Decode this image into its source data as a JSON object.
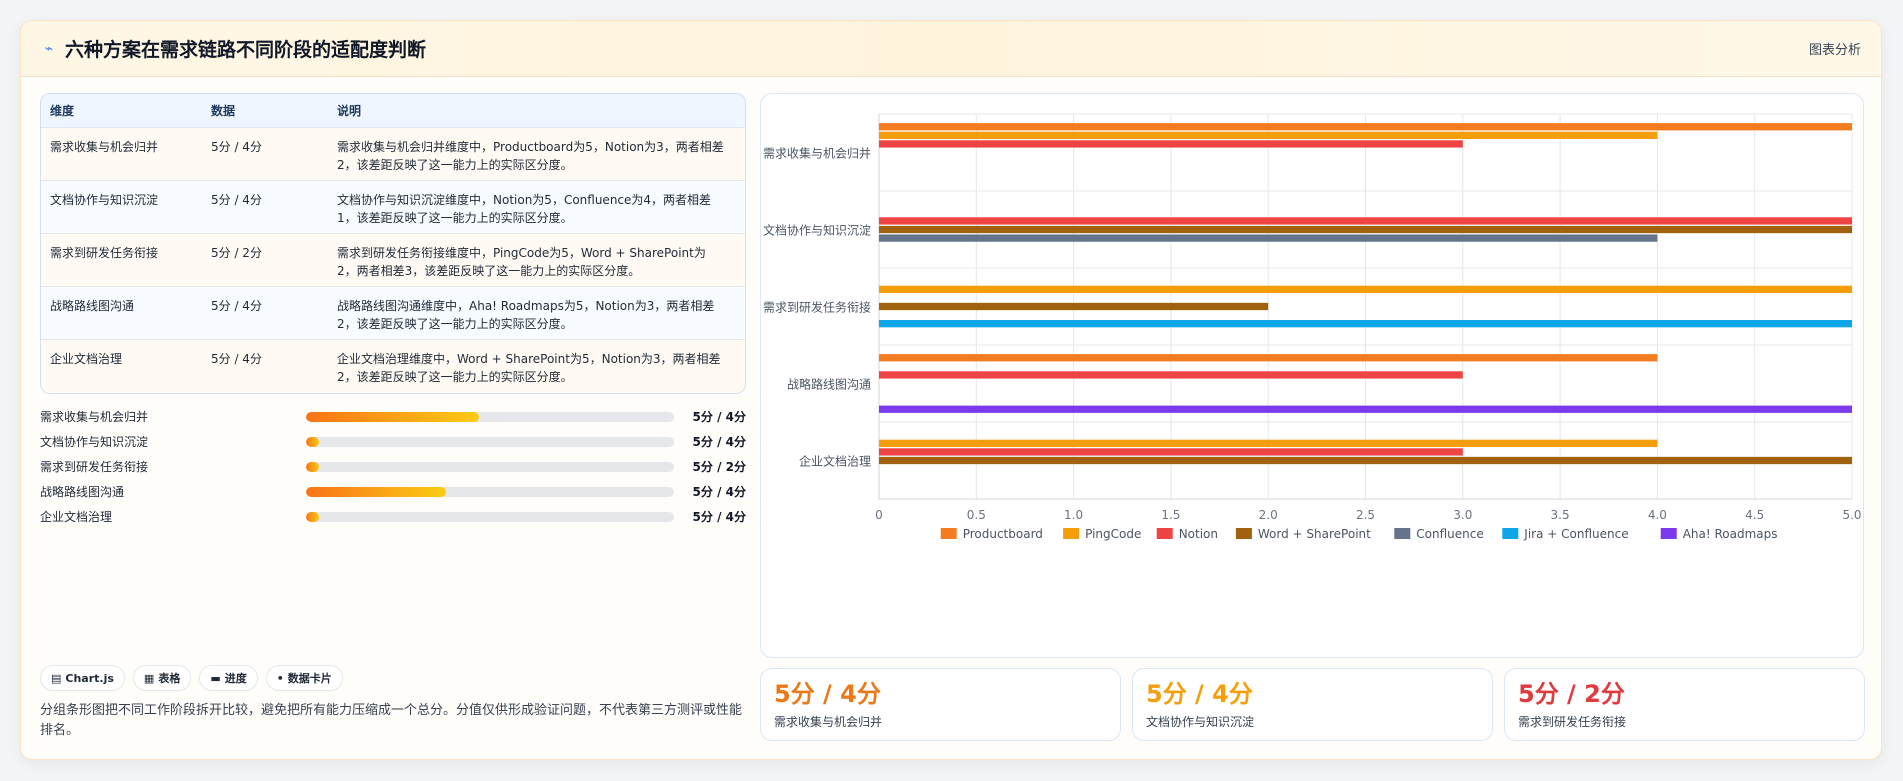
{
  "header": {
    "title": "六种方案在需求链路不同阶段的适配度判断",
    "link": "图表分析",
    "icon": "sparkle-icon"
  },
  "table": {
    "columns": [
      "维度",
      "数据",
      "说明"
    ],
    "rows": [
      {
        "dim": "需求收集与机会归并",
        "data": "5分 / 4分",
        "desc": "需求收集与机会归并维度中，Productboard为5，Notion为3，两者相差2，该差距反映了这一能力上的实际区分度。"
      },
      {
        "dim": "文档协作与知识沉淀",
        "data": "5分 / 4分",
        "desc": "文档协作与知识沉淀维度中，Notion为5，Confluence为4，两者相差1，该差距反映了这一能力上的实际区分度。"
      },
      {
        "dim": "需求到研发任务衔接",
        "data": "5分 / 2分",
        "desc": "需求到研发任务衔接维度中，PingCode为5，Word + SharePoint为2，两者相差3，该差距反映了这一能力上的实际区分度。"
      },
      {
        "dim": "战略路线图沟通",
        "data": "5分 / 4分",
        "desc": "战略路线图沟通维度中，Aha! Roadmaps为5，Notion为3，两者相差2，该差距反映了这一能力上的实际区分度。"
      },
      {
        "dim": "企业文档治理",
        "data": "5分 / 4分",
        "desc": "企业文档治理维度中，Word + SharePoint为5，Notion为3，两者相差2，该差距反映了这一能力上的实际区分度。"
      }
    ]
  },
  "progress": [
    {
      "label": "需求收集与机会归并",
      "value": "5分 / 4分",
      "fill": 0.47
    },
    {
      "label": "文档协作与知识沉淀",
      "value": "5分 / 4分",
      "fill": 0.035
    },
    {
      "label": "需求到研发任务衔接",
      "value": "5分 / 2分",
      "fill": 0.035
    },
    {
      "label": "战略路线图沟通",
      "value": "5分 / 4分",
      "fill": 0.38
    },
    {
      "label": "企业文档治理",
      "value": "5分 / 4分",
      "fill": 0.035
    }
  ],
  "chips": [
    {
      "icon": "chart-icon",
      "glyph": "▤",
      "label": "Chart.js"
    },
    {
      "icon": "table-icon",
      "glyph": "▦",
      "label": "表格"
    },
    {
      "icon": "progress-icon",
      "glyph": "▬",
      "label": "进度"
    },
    {
      "icon": "card-icon",
      "glyph": "•",
      "label": "数据卡片"
    }
  ],
  "note": "分组条形图把不同工作阶段拆开比较，避免把所有能力压缩成一个总分。分值仅供形成验证问题，不代表第三方测评或性能排名。",
  "stats": [
    {
      "value": "5分 / 4分",
      "label": "需求收集与机会归并",
      "color": "#ea7a17"
    },
    {
      "value": "5分 / 4分",
      "label": "文档协作与知识沉淀",
      "color": "#f59e0b"
    },
    {
      "value": "5分 / 2分",
      "label": "需求到研发任务衔接",
      "color": "#e0393e"
    }
  ],
  "chart_data": {
    "type": "bar",
    "orientation": "horizontal",
    "categories": [
      "需求收集与机会归并",
      "文档协作与知识沉淀",
      "需求到研发任务衔接",
      "战略路线图沟通",
      "企业文档治理"
    ],
    "series": [
      {
        "name": "Productboard",
        "color": "#f47c20",
        "values": [
          5,
          null,
          null,
          4,
          null
        ]
      },
      {
        "name": "PingCode",
        "color": "#f59e0b",
        "values": [
          4,
          null,
          5,
          null,
          4
        ]
      },
      {
        "name": "Notion",
        "color": "#ef4444",
        "values": [
          3,
          5,
          null,
          3,
          3
        ]
      },
      {
        "name": "Word + SharePoint",
        "color": "#a0620f",
        "values": [
          null,
          5,
          2,
          null,
          5
        ]
      },
      {
        "name": "Confluence",
        "color": "#64748b",
        "values": [
          null,
          4,
          null,
          null,
          null
        ]
      },
      {
        "name": "Jira + Confluence",
        "color": "#0ea5e9",
        "values": [
          null,
          null,
          5,
          null,
          null
        ]
      },
      {
        "name": "Aha! Roadmaps",
        "color": "#7c3aed",
        "values": [
          null,
          null,
          null,
          5,
          null
        ]
      }
    ],
    "xlim": [
      0,
      5
    ],
    "xticks": [
      "0",
      "0.5",
      "1.0",
      "1.5",
      "2.0",
      "2.5",
      "3.0",
      "3.5",
      "4.0",
      "4.5",
      "5.0"
    ],
    "legend": "bottom",
    "grid": true
  }
}
